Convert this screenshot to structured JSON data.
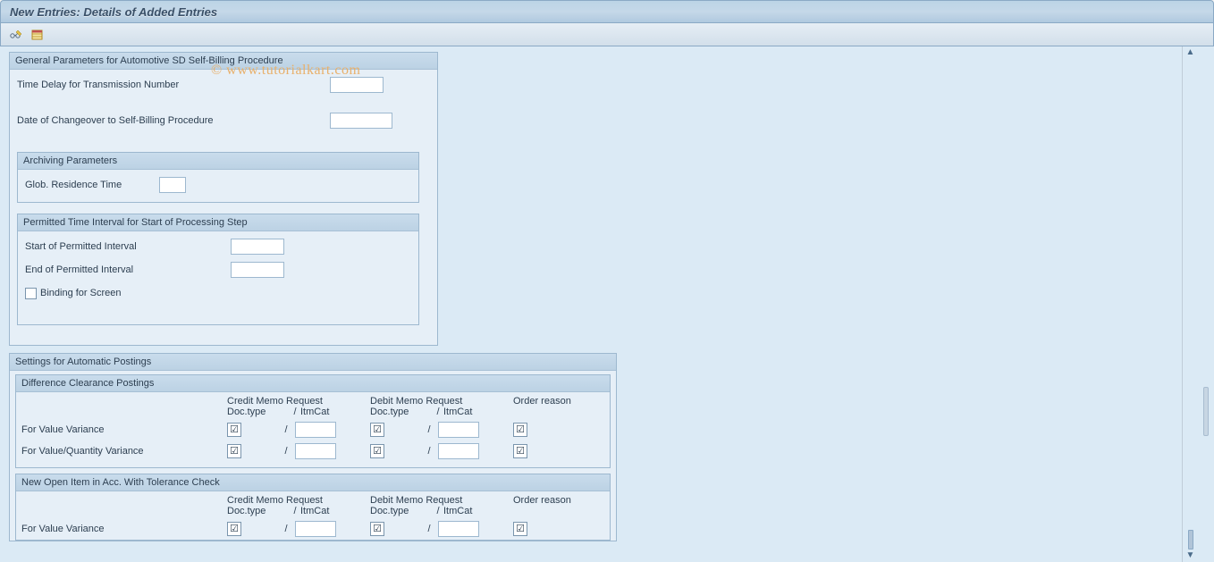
{
  "title": "New Entries: Details of Added Entries",
  "watermark": "© www.tutorialkart.com",
  "panel1": {
    "header": "General Parameters for Automotive SD Self-Billing Procedure",
    "time_delay_label": "Time Delay for Transmission Number",
    "time_delay_value": "",
    "changeover_label": "Date of Changeover to Self-Billing Procedure",
    "changeover_value": "",
    "archiving_header": "Archiving Parameters",
    "glob_residence_label": "Glob. Residence Time",
    "glob_residence_value": "",
    "permitted_header": "Permitted Time Interval for Start of Processing Step",
    "start_label": "Start of Permitted Interval",
    "start_value": "",
    "end_label": "End of Permitted Interval",
    "end_value": "",
    "binding_label": "Binding for Screen"
  },
  "panel2": {
    "header": "Settings for Automatic Postings",
    "sub_diff_header": "Difference Clearance Postings",
    "sub_open_header": "New Open Item in Acc. With Tolerance Check",
    "col_credit": "Credit Memo Request",
    "col_debit": "Debit Memo Request",
    "col_order": "Order reason",
    "sub_doctype": "Doc.type",
    "sub_slash": "/",
    "sub_itmcat": "ItmCat",
    "row_value_variance": "For Value Variance",
    "row_value_qty_variance": "For Value/Quantity Variance",
    "check_symbol": "☑",
    "cells": {
      "diff_vv_credit_doc": "",
      "diff_vv_credit_itm": "",
      "diff_vv_debit_doc": "",
      "diff_vv_debit_itm": "",
      "diff_vv_order": "",
      "diff_vqv_credit_doc": "",
      "diff_vqv_credit_itm": "",
      "diff_vqv_debit_doc": "",
      "diff_vqv_debit_itm": "",
      "diff_vqv_order": "",
      "open_vv_credit_doc": "",
      "open_vv_credit_itm": "",
      "open_vv_debit_doc": "",
      "open_vv_debit_itm": "",
      "open_vv_order": ""
    }
  }
}
